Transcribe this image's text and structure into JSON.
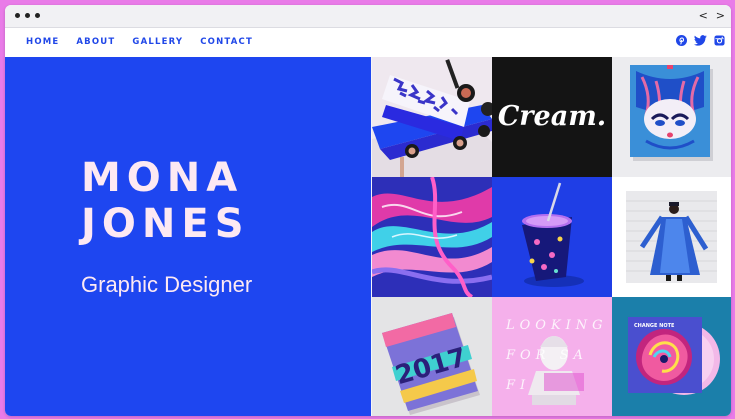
{
  "window": {
    "controls": [
      "dot",
      "dot",
      "dot"
    ],
    "nav": {
      "back": "<",
      "forward": ">"
    }
  },
  "site": {
    "menu": [
      "HOME",
      "ABOUT",
      "GALLERY",
      "CONTACT"
    ],
    "social": [
      "pinterest-icon",
      "twitter-icon",
      "instagram-icon"
    ]
  },
  "hero": {
    "first_name": "MONA",
    "last_name": "JONES",
    "role": "Graphic Designer"
  },
  "gallery": {
    "cream_text": "Cream.",
    "book_text": "2017",
    "poster_text_1": "LOOKING",
    "poster_text_2": "FOR SA",
    "poster_text_3": "FI",
    "record_text": "CHANGE\nNOTE",
    "tiles": [
      "3d-pipes-artwork",
      "cream-logo",
      "tshirt-print",
      "fluid-abstract-art",
      "drink-cup-photo",
      "fashion-photo",
      "book-2017-cover",
      "bust-poster",
      "vinyl-record-cover"
    ]
  },
  "colors": {
    "brand_blue": "#1e46f0",
    "page_pink": "#e97be8",
    "hero_text": "#fde9f3"
  }
}
